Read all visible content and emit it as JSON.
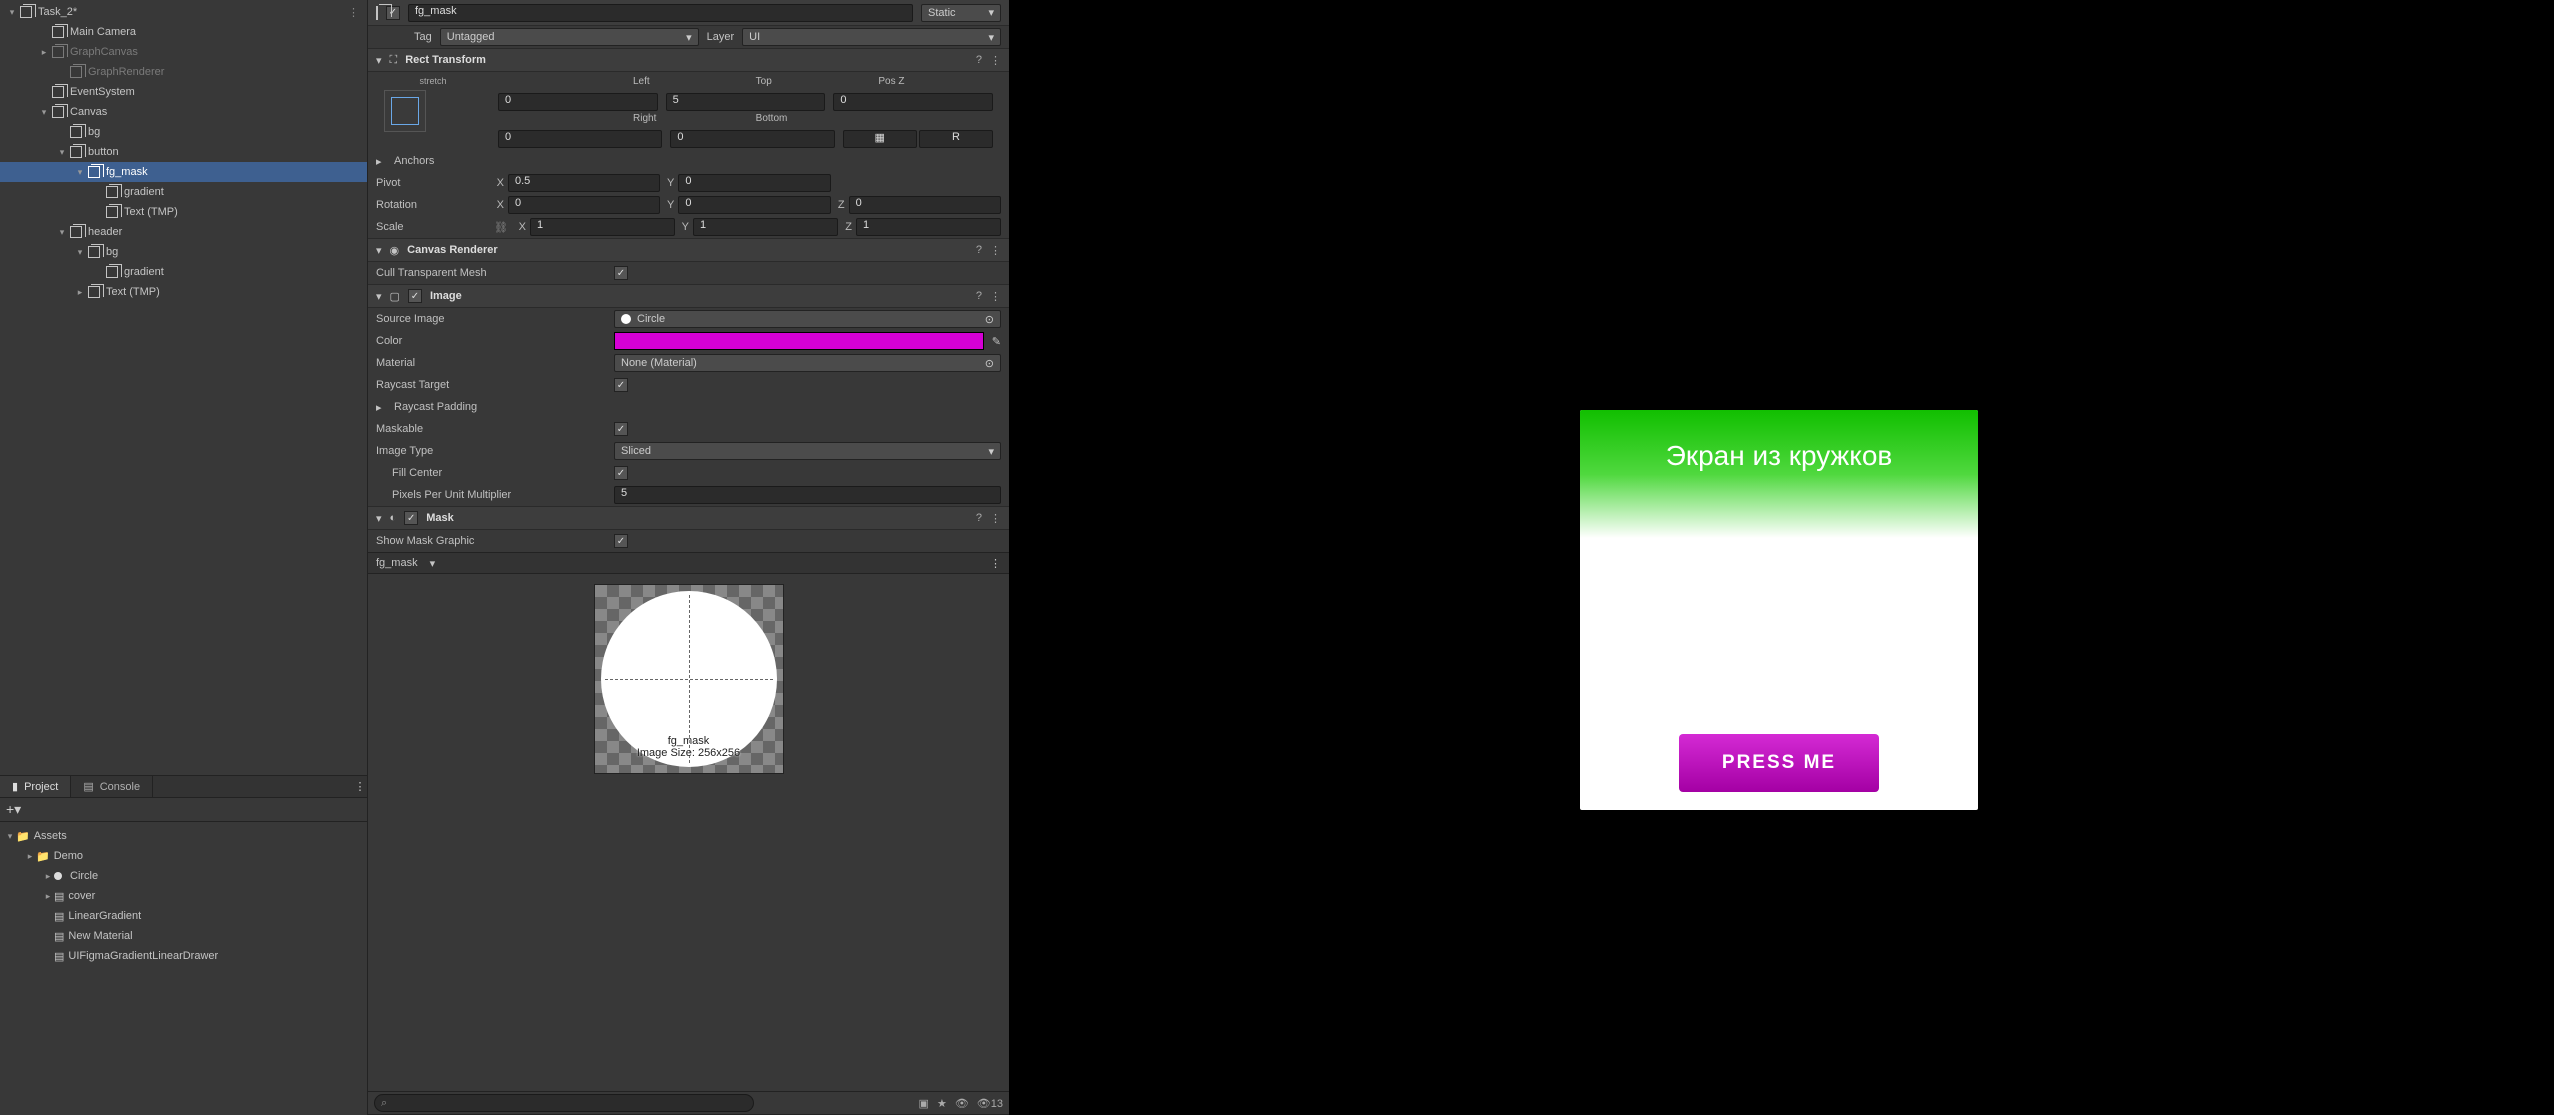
{
  "hierarchy": {
    "scene": "Task_2*",
    "items": [
      {
        "label": "Main Camera",
        "indent": 1
      },
      {
        "label": "GraphCanvas",
        "indent": 1,
        "dim": true,
        "fold": "▸"
      },
      {
        "label": "GraphRenderer",
        "indent": 2,
        "dim": true
      },
      {
        "label": "EventSystem",
        "indent": 1
      },
      {
        "label": "Canvas",
        "indent": 1,
        "fold": "▾"
      },
      {
        "label": "bg",
        "indent": 2
      },
      {
        "label": "button",
        "indent": 2,
        "fold": "▾"
      },
      {
        "label": "fg_mask",
        "indent": 3,
        "fold": "▾",
        "sel": true
      },
      {
        "label": "gradient",
        "indent": 4
      },
      {
        "label": "Text (TMP)",
        "indent": 4
      },
      {
        "label": "header",
        "indent": 2,
        "fold": "▾"
      },
      {
        "label": "bg",
        "indent": 3,
        "fold": "▾"
      },
      {
        "label": "gradient",
        "indent": 4
      },
      {
        "label": "Text (TMP)",
        "indent": 3,
        "fold": "▸"
      }
    ]
  },
  "inspector": {
    "name": "fg_mask",
    "static": "Static",
    "tag_lbl": "Tag",
    "tag_val": "Untagged",
    "layer_lbl": "Layer",
    "layer_val": "UI",
    "rect": {
      "title": "Rect Transform",
      "stretch": "stretch",
      "left_l": "Left",
      "left": "0",
      "top_l": "Top",
      "top": "5",
      "posz_l": "Pos Z",
      "posz": "0",
      "right_l": "Right",
      "right": "0",
      "bottom_l": "Bottom",
      "bottom": "0",
      "anchors": "Anchors",
      "pivot": "Pivot",
      "px": "0.5",
      "py": "0",
      "rotation": "Rotation",
      "rx": "0",
      "ry": "0",
      "rz": "0",
      "scale": "Scale",
      "sx": "1",
      "sy": "1",
      "sz": "1"
    },
    "canvas_renderer": {
      "title": "Canvas Renderer",
      "cull": "Cull Transparent Mesh"
    },
    "image": {
      "title": "Image",
      "source": "Source Image",
      "source_v": "Circle",
      "color": "Color",
      "material": "Material",
      "material_v": "None (Material)",
      "raycast": "Raycast Target",
      "raypad": "Raycast Padding",
      "maskable": "Maskable",
      "type": "Image Type",
      "type_v": "Sliced",
      "fill": "Fill Center",
      "ppu": "Pixels Per Unit Multiplier",
      "ppu_v": "5"
    },
    "mask": {
      "title": "Mask",
      "show": "Show Mask Graphic"
    },
    "dropdown": "fg_mask",
    "preview_name": "fg_mask",
    "preview_size": "Image Size: 256x256"
  },
  "project": {
    "tab_project": "Project",
    "tab_console": "Console",
    "assets": "Assets",
    "items": [
      "Demo",
      "Circle",
      "cover",
      "LinearGradient",
      "New Material",
      "UIFigmaGradientLinearDrawer"
    ],
    "count": "13"
  },
  "game": {
    "header": "Экран из кружков",
    "button": "PRESS ME"
  }
}
